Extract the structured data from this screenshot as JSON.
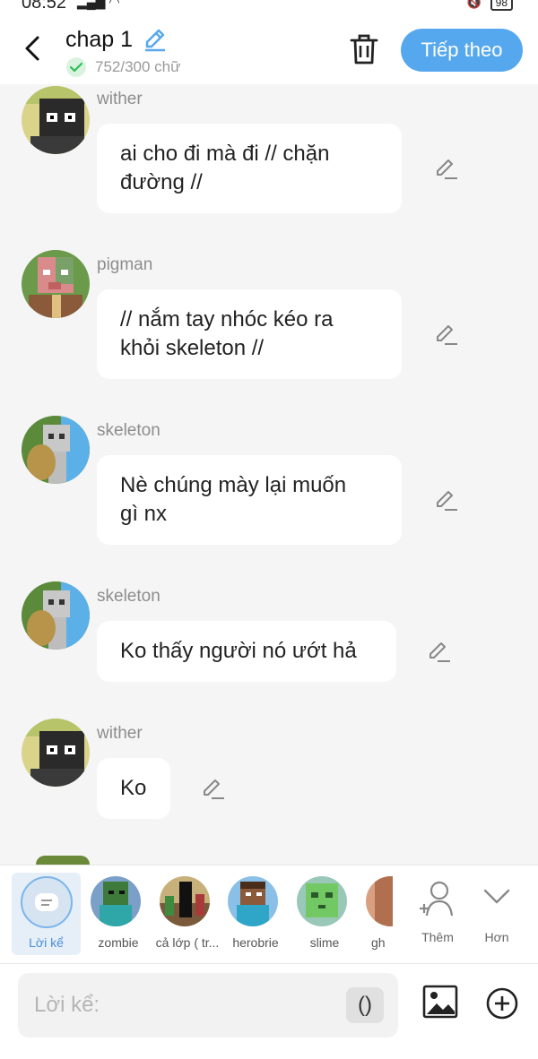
{
  "status_bar": {
    "time": "08:52",
    "battery": "98"
  },
  "header": {
    "title": "chap 1",
    "word_count": "752/300 chữ",
    "next_label": "Tiếp theo"
  },
  "messages": [
    {
      "name": "wither",
      "text": "ai cho đi mà đi // chặn\nđường //"
    },
    {
      "name": "pigman",
      "text": "// nắm tay nhóc kéo ra\nkhỏi skeleton //"
    },
    {
      "name": "skeleton",
      "text": "Nè chúng mày lại muốn\ngì nx"
    },
    {
      "name": "skeleton",
      "text": "Ko thấy người nó ướt hả"
    },
    {
      "name": "wither",
      "text": "Ko"
    }
  ],
  "character_bar": {
    "narrator_label": "Lời kể",
    "characters": [
      {
        "label": "zombie"
      },
      {
        "label": "cả lớp ( tr..."
      },
      {
        "label": "herobrie"
      },
      {
        "label": "slime"
      },
      {
        "label": "gh"
      }
    ],
    "add_label": "Thêm",
    "more_label": "Hơn"
  },
  "composer": {
    "placeholder": "Lời kể:",
    "paren_label": "()"
  },
  "colors": {
    "accent": "#56a8ee",
    "background": "#f5f5f5"
  }
}
